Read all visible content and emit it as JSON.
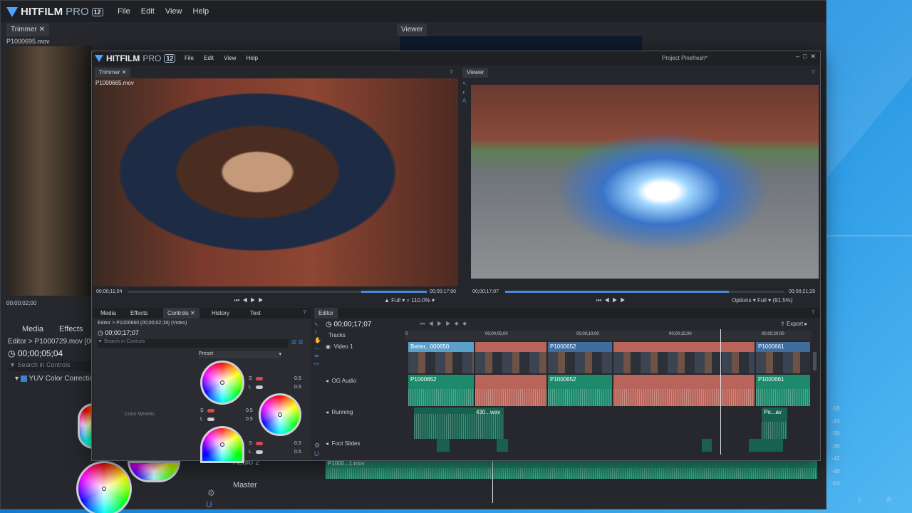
{
  "back": {
    "logo": {
      "hit": "HITFILM",
      "pro": "PRO",
      "ver": "12"
    },
    "menu": [
      "File",
      "Edit",
      "View",
      "Help"
    ],
    "trimmer_tab": "Trimmer",
    "trimmer_file": "P1000695.mov",
    "trimmer_time": "00;00;02;00",
    "viewer_tab": "Viewer",
    "tabs": [
      "Media",
      "Effects"
    ],
    "editor_path": "Editor > P1000729.mov [00",
    "time": "00;00;05;04",
    "search_placeholder": "Search in Controls",
    "effect_label": "YUV Color Correctio",
    "audio2": "Audio 2",
    "master": "Master",
    "clip_label": "P1000...1.mov",
    "meter_ticks": [
      "-18",
      "-24",
      "-30",
      "-36",
      "-42",
      "-48",
      "-54"
    ],
    "meter_lr": [
      "L",
      "R"
    ]
  },
  "front": {
    "logo": {
      "hit": "HITFILM",
      "pro": "PRO",
      "ver": "12"
    },
    "menu": [
      "File",
      "Edit",
      "View",
      "Help"
    ],
    "project": "Project Pinefresh*",
    "trimmer": {
      "tab": "Trimmer",
      "file": "P1000665.mov",
      "time_in": "00;00;11;04",
      "time_out": "00;00;17;00",
      "quality": "Full",
      "zoom": "110.0%"
    },
    "viewer": {
      "tab": "Viewer",
      "time_in": "00;00;17;07",
      "time_out": "00;00;21;29",
      "options": "Options",
      "quality": "Full",
      "zoom": "(91.5%)"
    },
    "panel_tabs": [
      "Media",
      "Effects",
      "Controls",
      "History",
      "Text"
    ],
    "controls": {
      "path": "Editor > P1000660 [00;00;02;18] (Video)",
      "time": "00;00;17;07",
      "search_placeholder": "Search in Controls",
      "preset": "Preset",
      "wheels_label": "Color Wheels",
      "s": "S",
      "l": "L",
      "values": [
        "0.5",
        "0.5",
        "0.5",
        "0.5",
        "0.5",
        "0.5"
      ]
    },
    "editor": {
      "tab": "Editor",
      "time": "00;00;17;07",
      "export": "Export",
      "tracks": "Tracks",
      "ticks": [
        "0",
        "00;00;05;00",
        "00;00;10;00",
        "00;00;15;00",
        "00;00;20;00"
      ],
      "track_names": [
        "Video 1",
        "OG Audio",
        "Running",
        "Foot Slides"
      ],
      "video_clips": [
        "Better...000650",
        "P1000652",
        "P1000661"
      ],
      "audio_clips": [
        "P1000652",
        "P1000652",
        "P1000661"
      ],
      "running_clips": [
        "430...wav",
        "Po...av"
      ]
    }
  },
  "colors": {
    "accent": "#4b8ad6",
    "green_clip": "#1e8a6c",
    "red_clip": "#b8645a",
    "video_clip": "#3f6d9f"
  }
}
